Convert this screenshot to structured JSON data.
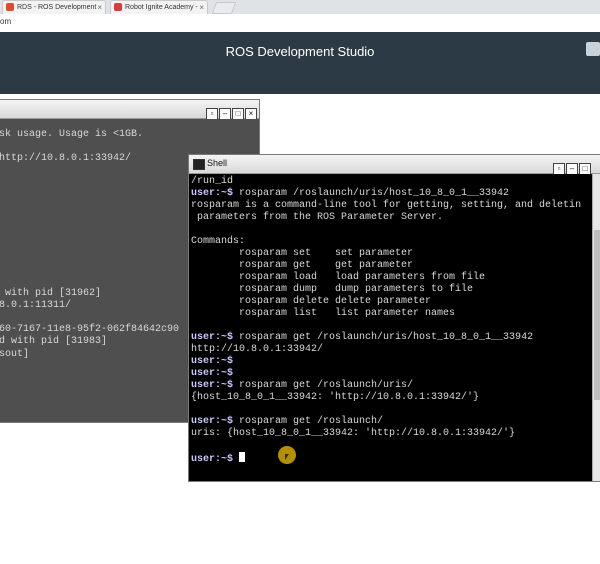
{
  "browser": {
    "tabs": [
      {
        "label": "RDS - ROS Development",
        "close": "×"
      },
      {
        "label": "Robot Ignite Academy - ",
        "close": "×"
      }
    ],
    "address_fragment": "om"
  },
  "header": {
    "title": "ROS Development Studio"
  },
  "back_terminal": {
    "lines": [
      "sk usage. Usage is <1GB.",
      "",
      "http://10.8.0.1:33942/",
      "",
      "",
      "",
      "",
      "",
      "",
      "",
      "",
      "",
      "",
      " with pid [31962]",
      "8.0.1:11311/",
      "",
      "60-7167-11e8-95f2-062f84642c90",
      "d with pid [31983]",
      "sout]"
    ]
  },
  "shell": {
    "title": "Shell",
    "lines": [
      {
        "prompt": "",
        "text": "/run_id"
      },
      {
        "prompt": "user:~$",
        "text": " rosparam /roslaunch/uris/host_10_8_0_1__33942"
      },
      {
        "prompt": "",
        "text": "rosparam is a command-line tool for getting, setting, and deletin"
      },
      {
        "prompt": "",
        "text": " parameters from the ROS Parameter Server."
      },
      {
        "prompt": "",
        "text": ""
      },
      {
        "prompt": "",
        "text": "Commands:"
      },
      {
        "prompt": "",
        "text": "        rosparam set    set parameter"
      },
      {
        "prompt": "",
        "text": "        rosparam get    get parameter"
      },
      {
        "prompt": "",
        "text": "        rosparam load   load parameters from file"
      },
      {
        "prompt": "",
        "text": "        rosparam dump   dump parameters to file"
      },
      {
        "prompt": "",
        "text": "        rosparam delete delete parameter"
      },
      {
        "prompt": "",
        "text": "        rosparam list   list parameter names"
      },
      {
        "prompt": "",
        "text": ""
      },
      {
        "prompt": "user:~$",
        "text": " rosparam get /roslaunch/uris/host_10_8_0_1__33942"
      },
      {
        "prompt": "",
        "text": "http://10.8.0.1:33942/"
      },
      {
        "prompt": "user:~$",
        "text": ""
      },
      {
        "prompt": "user:~$",
        "text": ""
      },
      {
        "prompt": "user:~$",
        "text": " rosparam get /roslaunch/uris/"
      },
      {
        "prompt": "",
        "text": "{host_10_8_0_1__33942: 'http://10.8.0.1:33942/'}"
      },
      {
        "prompt": "",
        "text": ""
      },
      {
        "prompt": "user:~$",
        "text": " rosparam get /roslaunch/"
      },
      {
        "prompt": "",
        "text": "uris: {host_10_8_0_1__33942: 'http://10.8.0.1:33942/'}"
      },
      {
        "prompt": "",
        "text": ""
      },
      {
        "prompt": "user:~$",
        "text": " "
      }
    ]
  },
  "window_buttons": {
    "restore": "",
    "minimize": "",
    "maximize": "",
    "close": "×"
  },
  "colors": {
    "header": "#2b3a44",
    "terminal_bg": "#000000",
    "prompt": "#c8c8ff"
  }
}
